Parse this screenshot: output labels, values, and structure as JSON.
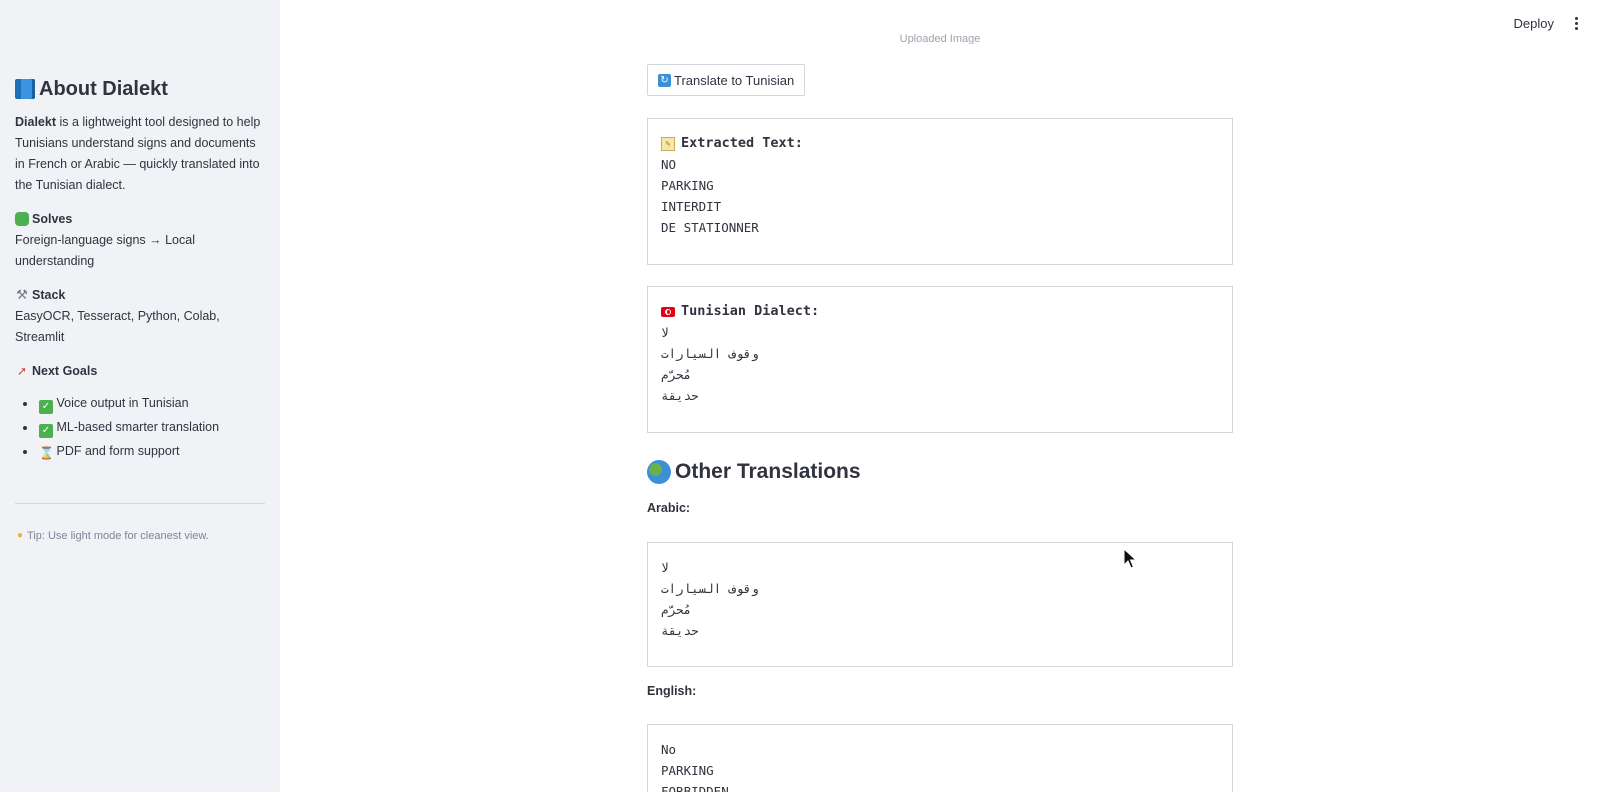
{
  "header": {
    "deploy_label": "Deploy"
  },
  "sidebar": {
    "title": "About Dialekt",
    "intro_bold": "Dialekt",
    "intro_rest": " is a lightweight tool designed to help Tunisians understand signs and documents in French or Arabic — quickly translated into the Tunisian dialect.",
    "solves_title": "Solves",
    "solves_body": "Foreign-language signs → Local understanding",
    "stack_title": "Stack",
    "stack_body": "EasyOCR, Tesseract, Python, Colab, Streamlit",
    "goals_title": "Next Goals",
    "goals": [
      {
        "icon": "check-mark-icon",
        "label": "Voice output in Tunisian"
      },
      {
        "icon": "check-mark-icon",
        "label": "ML-based smarter translation"
      },
      {
        "icon": "hourglass-icon",
        "label": "PDF and form support"
      }
    ],
    "tip": "Tip: Use light mode for cleanest view."
  },
  "main": {
    "uploaded_caption": "Uploaded Image",
    "translate_button": "Translate to Tunisian",
    "extracted": {
      "title": "Extracted Text:",
      "lines": [
        "NO",
        "PARKING",
        "INTERDIT",
        "DE STATIONNER"
      ]
    },
    "tunisian": {
      "title": "Tunisian Dialect:",
      "lines": [
        "لا",
        "وقوف السيارات",
        "مُحرّم",
        "حديقة"
      ]
    },
    "other_heading": "Other Translations",
    "arabic_label": "Arabic:",
    "arabic_lines": [
      "لا",
      "وقوف السيارات",
      "مُحرّم",
      "حديقة"
    ],
    "english_label": "English:",
    "english_lines": [
      "No",
      "PARKING",
      "FORBIDDEN"
    ]
  }
}
